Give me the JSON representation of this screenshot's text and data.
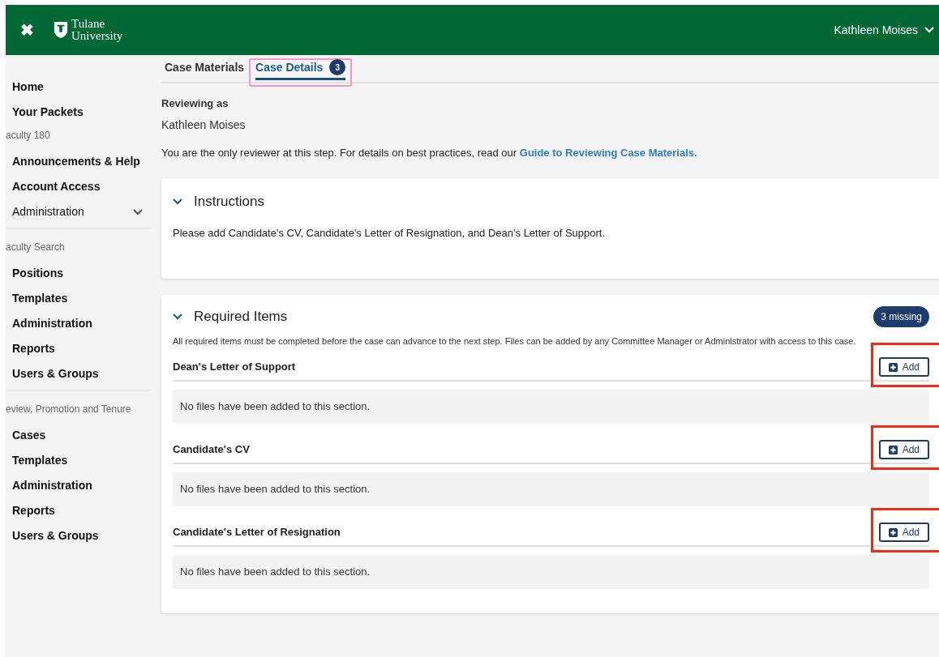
{
  "header": {
    "close_glyph": "✖",
    "logo_line1": "Tulane",
    "logo_line2": "University",
    "user": "Kathleen Moises"
  },
  "sidebar": {
    "groups": [
      {
        "items": [
          {
            "label": "Home",
            "kind": "link"
          },
          {
            "label": "Your Packets",
            "kind": "link"
          }
        ]
      },
      {
        "heading": "aculty 180",
        "items": [
          {
            "label": "Announcements & Help",
            "kind": "link"
          },
          {
            "label": "Account Access",
            "kind": "link"
          },
          {
            "label": "Administration",
            "kind": "menu"
          }
        ]
      },
      {
        "heading": "aculty Search",
        "items": [
          {
            "label": "Positions",
            "kind": "link"
          },
          {
            "label": "Templates",
            "kind": "link"
          },
          {
            "label": "Administration",
            "kind": "link"
          },
          {
            "label": "Reports",
            "kind": "link"
          },
          {
            "label": "Users & Groups",
            "kind": "link"
          }
        ]
      },
      {
        "heading": "eview, Promotion and Tenure",
        "items": [
          {
            "label": "Cases",
            "kind": "link"
          },
          {
            "label": "Templates",
            "kind": "link"
          },
          {
            "label": "Administration",
            "kind": "link"
          },
          {
            "label": "Reports",
            "kind": "link"
          },
          {
            "label": "Users & Groups",
            "kind": "link"
          }
        ]
      }
    ]
  },
  "tabs": [
    {
      "label": "Case Materials",
      "selected": false,
      "highlighted": false
    },
    {
      "label": "Case Details",
      "selected": true,
      "badge": "3",
      "highlighted": true
    }
  ],
  "reviewing": {
    "label": "Reviewing as",
    "name": "Kathleen Moises"
  },
  "notice": {
    "text": "You are the only reviewer at this step. For details on best practices, read our",
    "link": "Guide to Reviewing Case Materials."
  },
  "instructions": {
    "title": "Instructions",
    "expanded": true,
    "text": "Please add Candidate's CV, Candidate's Letter of Resignation, and Dean's Letter of Support."
  },
  "required": {
    "title": "Required Items",
    "expanded": true,
    "badge": "3 missing",
    "text": "All required items must be completed before the case can advance to the next step. Files can be added by any Committee Manager or Administrator with access to this case.",
    "items": [
      {
        "title": "Dean's Letter of Support",
        "button": "Add",
        "empty": "No files have been added to this section.",
        "highlighted": true
      },
      {
        "title": "Candidate's CV",
        "button": "Add",
        "empty": "No files have been added to this section.",
        "highlighted": true
      },
      {
        "title": "Candidate's Letter of Resignation",
        "button": "Add",
        "empty": "No files have been added to this section.",
        "highlighted": true
      }
    ]
  }
}
